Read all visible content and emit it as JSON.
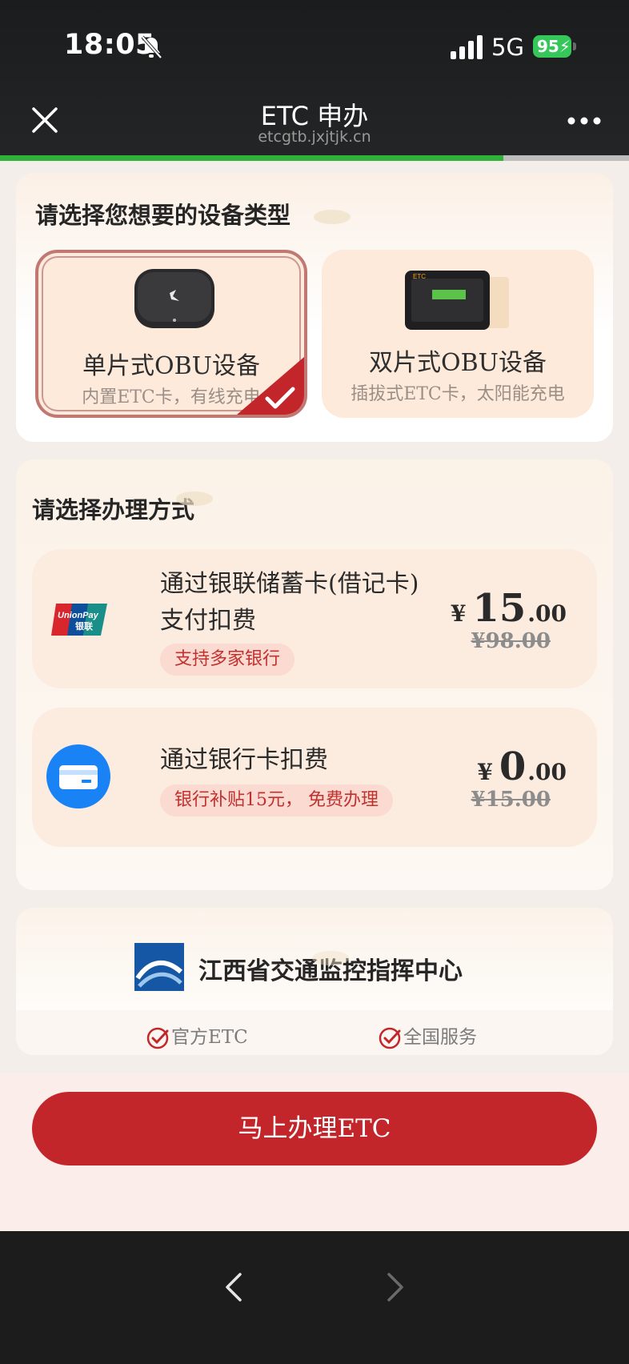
{
  "status_bar": {
    "time": "18:05",
    "network": "5G",
    "battery": "95"
  },
  "header": {
    "title": "ETC 申办",
    "subtitle": "etcgtb.jxjtjk.cn",
    "progress": 0.8
  },
  "device_section": {
    "title": "请选择您想要的设备类型",
    "options": [
      {
        "name": "单片式OBU设备",
        "desc": "内置ETC卡，有线充电",
        "selected": true
      },
      {
        "name": "双片式OBU设备",
        "desc": "插拔式ETC卡，太阳能充电",
        "selected": false
      }
    ]
  },
  "method_section": {
    "title": "请选择办理方式",
    "options": [
      {
        "line1": "通过银联储蓄卡(借记卡)",
        "line2": "支付扣费",
        "tag": "支持多家银行",
        "currency": "¥",
        "price_int": "15",
        "price_dec": ".00",
        "old_price": "¥98.00",
        "icon": "unionpay-logo"
      },
      {
        "line1": "通过银行卡扣费",
        "tag": "银行补贴15元， 免费办理",
        "currency": "¥",
        "price_int": "0",
        "price_dec": ".00",
        "old_price": "¥15.00",
        "icon": "bank-card-icon"
      }
    ]
  },
  "provider": {
    "name": "江西省交通监控指挥中心",
    "badges": [
      "官方ETC",
      "全国服务"
    ]
  },
  "cta": {
    "label": "马上办理ETC"
  },
  "colors": {
    "accent": "#c3262a",
    "progress": "#2fb23a",
    "tag_text": "#c3312f"
  }
}
